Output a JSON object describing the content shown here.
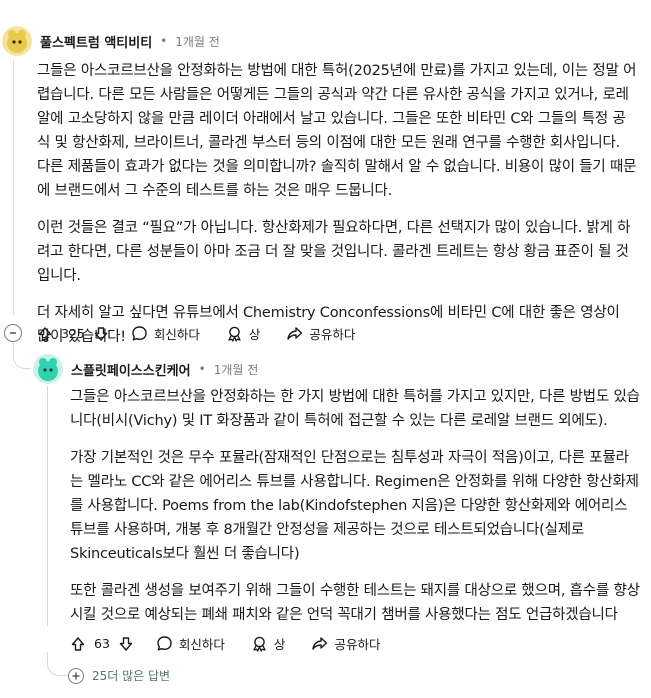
{
  "comment1": {
    "username": "풀스펙트럼 액티비티",
    "time": "1개월 전",
    "paragraphs": [
      "그들은 아스코르브산을 안정화하는 방법에 대한 특허(2025년에 만료)를 가지고 있는데, 이는 정말 어렵습니다. 다른 모든 사람들은 어떻게든 그들의 공식과 약간 다른 유사한 공식을 가지고 있거나, 로레알에 고소당하지 않을 만큼 레이더 아래에서 날고 있습니다. 그들은 또한 비타민 C와 그들의 특정 공식 및 항산화제, 브라이트너, 콜라겐 부스터 등의 이점에 대한 모든 원래 연구를 수행한 회사입니다. 다른 제품들이 효과가 없다는 것을 의미합니까? 솔직히 말해서 알 수 없습니다. 비용이 많이 들기 때문에 브랜드에서 그 수준의 테스트를 하는 것은 매우 드뭅니다.",
      "이런 것들은 결코 “필요”가 아닙니다. 항산화제가 필요하다면, 다른 선택지가 많이 있습니다. 밝게 하려고 한다면, 다른 성분들이 아마 조금 더 잘 맞을 것입니다. 콜라겐 트레트는 항상 황금 표준이 될 것입니다.",
      "더 자세히 알고 싶다면 유튜브에서 Chemistry Conconfessions에 비타민 C에 대한 좋은 영상이 많이 있습니다!"
    ],
    "votes": "325",
    "reply_label": "회신하다",
    "award_label": "상",
    "share_label": "공유하다"
  },
  "comment2": {
    "username": "스플릿페이스스킨케어",
    "time": "1개월 전",
    "paragraphs": [
      "그들은 아스코르브산을 안정화하는 한 가지 방법에 대한 특허를 가지고 있지만, 다른 방법도 있습니다(비시(Vichy) 및 IT 화장품과 같이 특허에 접근할 수 있는 다른 로레알 브랜드 외에도).",
      "가장 기본적인 것은 무수 포뮬라(잠재적인 단점으로는 침투성과 자극이 적음)이고, 다른 포뮬라는 멜라노 CC와 같은 에어리스 튜브를 사용합니다. Regimen은 안정화를 위해 다양한 항산화제를 사용합니다. Poems from the lab(Kindofstephen 지음)은 다양한 항산화제와 에어리스 튜브를 사용하며, 개봉 후 8개월간 안정성을 제공하는 것으로 테스트되었습니다(실제로 Skinceuticals보다 훨씬 더 좋습니다)",
      "또한 콜라겐 생성을 보여주기 위해 그들이 수행한 테스트는 돼지를 대상으로 했으며, 흡수를 향상시킬 것으로 예상되는 폐쇄 패치와 같은 언덕 꼭대기 챔버를 사용했다는 점도 언급하겠습니다"
    ],
    "votes": "63",
    "reply_label": "회신하다",
    "award_label": "상",
    "share_label": "공유하다"
  },
  "more_replies": "25더 많은 답변",
  "colors": {
    "avatar1": "#e8c94a",
    "avatar2": "#2fd3b1",
    "muted": "#7c7c7c"
  }
}
